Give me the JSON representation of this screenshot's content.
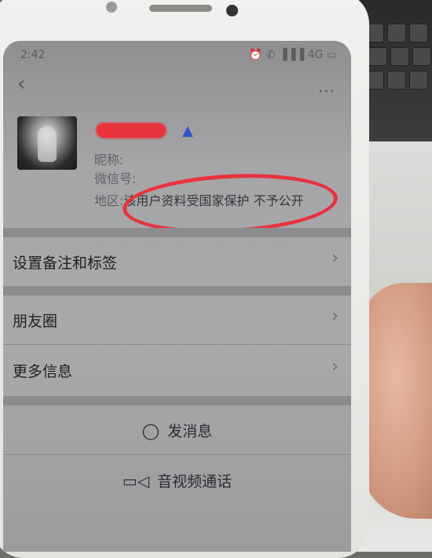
{
  "status_bar": {
    "time": "2:42",
    "icons": "⏰ ✆ ▐▐▐ 4G ▭"
  },
  "profile": {
    "nickname_label": "昵称:",
    "wechat_label": "微信号:",
    "region_label": "地区:",
    "region_value": "该用户资料受国家保护 不予公开"
  },
  "rows": {
    "remark": "设置备注和标签",
    "moments": "朋友圈",
    "more_info": "更多信息"
  },
  "actions": {
    "send_message": "发消息",
    "video_call": "音视频通话"
  },
  "colors": {
    "annotation_red": "#e8323c",
    "screen_gray": "#a6a6a8"
  }
}
